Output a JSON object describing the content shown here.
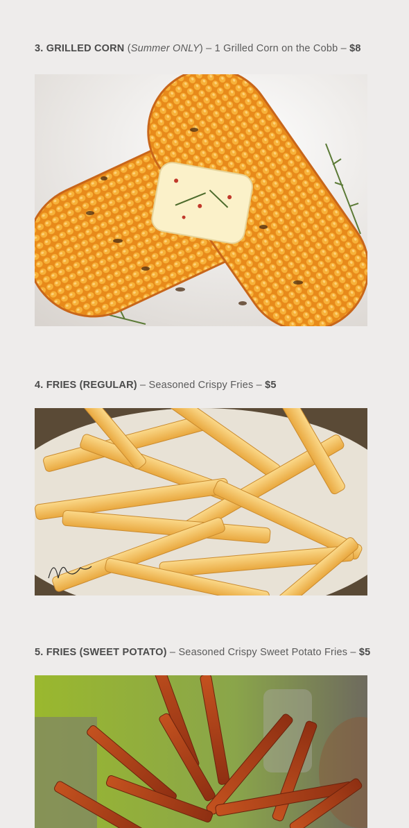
{
  "items": [
    {
      "number_name": "3. GRILLED CORN",
      "qualifier": "Summer ONLY",
      "description": "1 Grilled Corn on the Cobb",
      "price": "$8",
      "image": "grilled-corn-photo"
    },
    {
      "number_name": "4. FRIES (REGULAR)",
      "description": "Seasoned Crispy Fries",
      "price": "$5",
      "image": "regular-fries-photo"
    },
    {
      "number_name": "5. FRIES (SWEET POTATO)",
      "description": "Seasoned Crispy Sweet Potato Fries",
      "price": "$5",
      "image": "sweet-potato-fries-photo"
    }
  ],
  "colors": {
    "background": "#eeeceb",
    "text": "#5a5a5a",
    "corn": "#f0a030",
    "fries": "#f2c060",
    "sweet_potato": "#b5461d"
  }
}
